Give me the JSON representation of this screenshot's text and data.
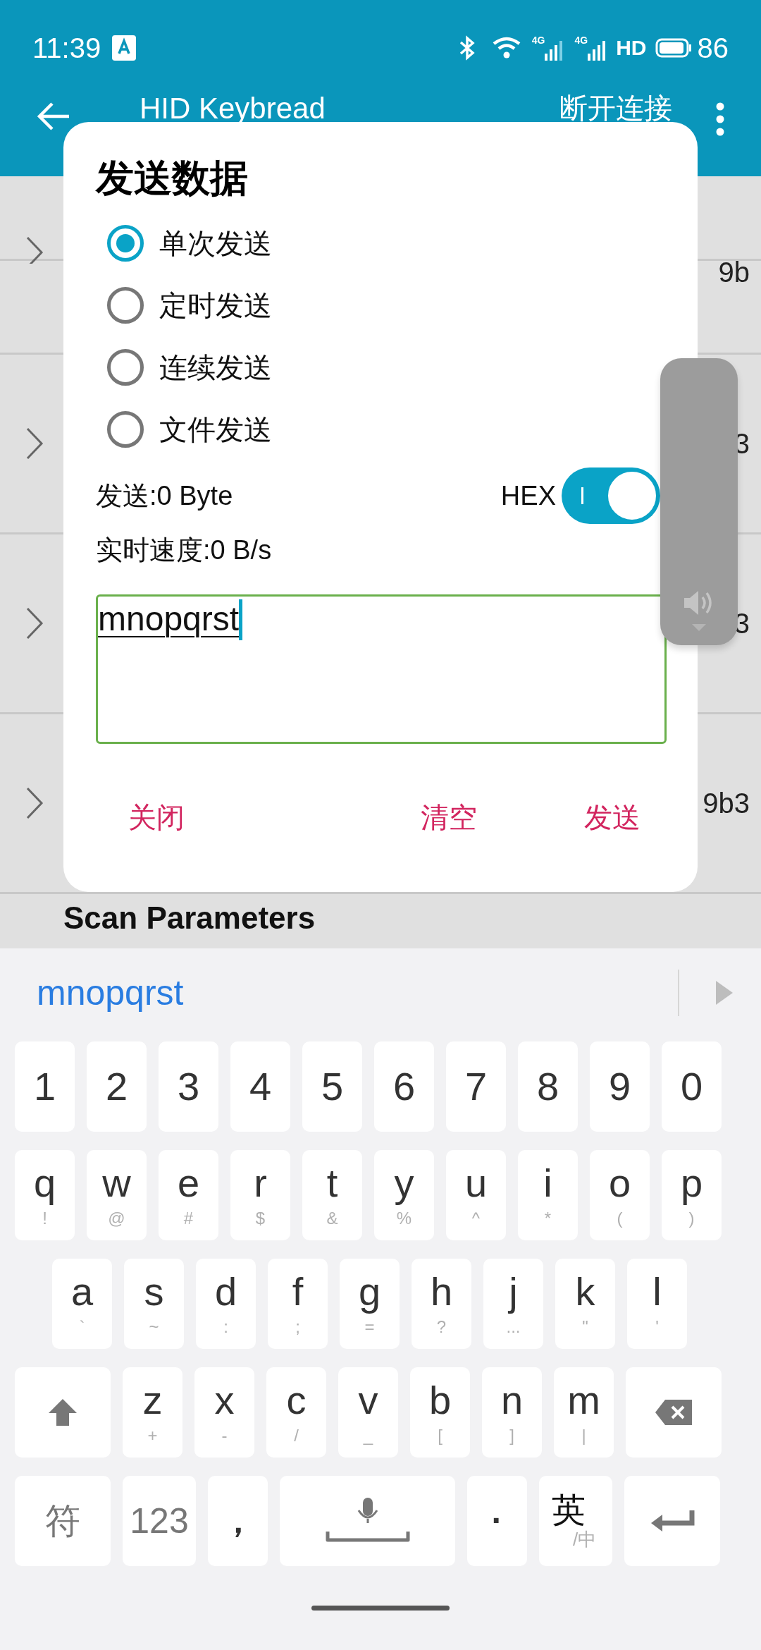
{
  "status_bar": {
    "time": "11:39",
    "network": [
      "4G",
      "4G"
    ],
    "hd": "HD",
    "battery": "86"
  },
  "app_bar": {
    "title": "HID Keybread",
    "action": "断开连接"
  },
  "list": {
    "rows": [
      {
        "value": "9b"
      },
      {
        "value": "3"
      },
      {
        "value": "3"
      },
      {
        "value": "9b3"
      }
    ],
    "section": "Scan Parameters"
  },
  "dialog": {
    "title": "发送数据",
    "options": [
      {
        "label": "单次发送",
        "selected": true
      },
      {
        "label": "定时发送",
        "selected": false
      },
      {
        "label": "连续发送",
        "selected": false
      },
      {
        "label": "文件发送",
        "selected": false
      }
    ],
    "sent": "发送:0 Byte",
    "hex": {
      "label": "HEX",
      "on": true
    },
    "speed": "实时速度:0 B/s",
    "input": {
      "value": "mnopqrst"
    },
    "buttons": [
      "关闭",
      "清空",
      "发送"
    ]
  },
  "keyboard": {
    "suggestion": "mnopqrst",
    "rows": [
      {
        "keys": [
          {
            "kind": "char",
            "label": "1"
          },
          {
            "kind": "char",
            "label": "2"
          },
          {
            "kind": "char",
            "label": "3"
          },
          {
            "kind": "char",
            "label": "4"
          },
          {
            "kind": "char",
            "label": "5"
          },
          {
            "kind": "char",
            "label": "6"
          },
          {
            "kind": "char",
            "label": "7"
          },
          {
            "kind": "char",
            "label": "8"
          },
          {
            "kind": "char",
            "label": "9"
          },
          {
            "kind": "char",
            "label": "0"
          }
        ]
      },
      {
        "keys": [
          {
            "kind": "char",
            "label": "q",
            "sub": "!"
          },
          {
            "kind": "char",
            "label": "w",
            "sub": "@"
          },
          {
            "kind": "char",
            "label": "e",
            "sub": "#"
          },
          {
            "kind": "char",
            "label": "r",
            "sub": "$"
          },
          {
            "kind": "char",
            "label": "t",
            "sub": "&"
          },
          {
            "kind": "char",
            "label": "y",
            "sub": "%"
          },
          {
            "kind": "char",
            "label": "u",
            "sub": "^"
          },
          {
            "kind": "char",
            "label": "i",
            "sub": "*"
          },
          {
            "kind": "char",
            "label": "o",
            "sub": "("
          },
          {
            "kind": "char",
            "label": "p",
            "sub": ")"
          }
        ]
      },
      {
        "keys": [
          {
            "kind": "char",
            "label": "a",
            "sub": "`"
          },
          {
            "kind": "char",
            "label": "s",
            "sub": "~"
          },
          {
            "kind": "char",
            "label": "d",
            "sub": ":"
          },
          {
            "kind": "char",
            "label": "f",
            "sub": ";"
          },
          {
            "kind": "char",
            "label": "g",
            "sub": "="
          },
          {
            "kind": "char",
            "label": "h",
            "sub": "?"
          },
          {
            "kind": "char",
            "label": "j",
            "sub": "..."
          },
          {
            "kind": "char",
            "label": "k",
            "sub": "\""
          },
          {
            "kind": "char",
            "label": "l",
            "sub": "'"
          }
        ]
      },
      {
        "keys": [
          {
            "kind": "shift"
          },
          {
            "kind": "char",
            "label": "z",
            "sub": "+"
          },
          {
            "kind": "char",
            "label": "x",
            "sub": "-"
          },
          {
            "kind": "char",
            "label": "c",
            "sub": "/"
          },
          {
            "kind": "char",
            "label": "v",
            "sub": "_"
          },
          {
            "kind": "char",
            "label": "b",
            "sub": "["
          },
          {
            "kind": "char",
            "label": "n",
            "sub": "]"
          },
          {
            "kind": "char",
            "label": "m",
            "sub": "|"
          },
          {
            "kind": "backspace"
          }
        ]
      },
      {
        "keys": [
          {
            "kind": "text",
            "label": "符"
          },
          {
            "kind": "text",
            "label": "123"
          },
          {
            "kind": "char",
            "label": "，"
          },
          {
            "kind": "space"
          },
          {
            "kind": "char",
            "label": "·"
          },
          {
            "kind": "lang",
            "label": "英",
            "sub": "/中"
          },
          {
            "kind": "enter"
          }
        ]
      }
    ]
  }
}
